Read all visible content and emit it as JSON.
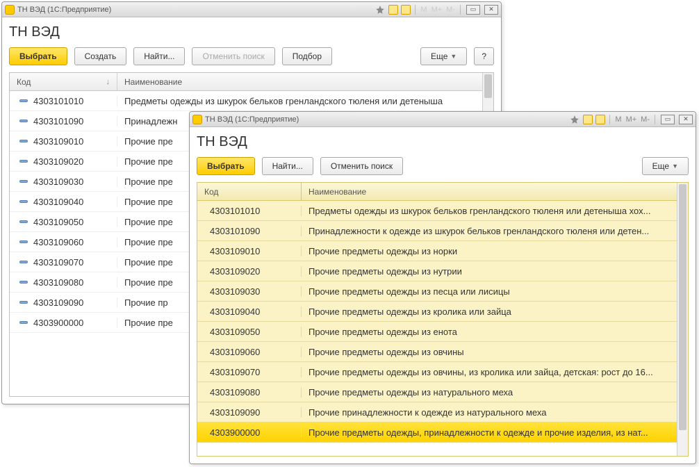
{
  "window1": {
    "title": "ТН ВЭД  (1С:Предприятие)",
    "page_title": "ТН ВЭД",
    "toolbar": {
      "choose": "Выбрать",
      "create": "Создать",
      "find": "Найти...",
      "cancel_search": "Отменить поиск",
      "pick": "Подбор",
      "more": "Еще",
      "help": "?"
    },
    "columns": {
      "code": "Код",
      "name": "Наименование"
    },
    "rows": [
      {
        "code": "4303101010",
        "name": "Предметы одежды из шкурок бельков гренландского тюленя или детеныша"
      },
      {
        "code": "4303101090",
        "name": "Принадлежн"
      },
      {
        "code": "4303109010",
        "name": "Прочие пре"
      },
      {
        "code": "4303109020",
        "name": "Прочие пре"
      },
      {
        "code": "4303109030",
        "name": "Прочие пре"
      },
      {
        "code": "4303109040",
        "name": "Прочие пре"
      },
      {
        "code": "4303109050",
        "name": "Прочие пре"
      },
      {
        "code": "4303109060",
        "name": "Прочие пре"
      },
      {
        "code": "4303109070",
        "name": "Прочие пре"
      },
      {
        "code": "4303109080",
        "name": "Прочие пре"
      },
      {
        "code": "4303109090",
        "name": "Прочие пр"
      },
      {
        "code": "4303900000",
        "name": "Прочие пре"
      }
    ]
  },
  "window2": {
    "title": "ТН ВЭД  (1С:Предприятие)",
    "page_title": "ТН ВЭД",
    "toolbar": {
      "choose": "Выбрать",
      "find": "Найти...",
      "cancel_search": "Отменить поиск",
      "more": "Еще"
    },
    "mem": {
      "m": "M",
      "mplus": "M+",
      "mminus": "M-"
    },
    "columns": {
      "code": "Код",
      "name": "Наименование"
    },
    "selected_index": 11,
    "rows": [
      {
        "code": "4303101010",
        "name": "Предметы одежды из шкурок бельков гренландского тюленя или детеныша хох..."
      },
      {
        "code": "4303101090",
        "name": "Принадлежности к одежде из шкурок бельков гренландского тюленя или детен..."
      },
      {
        "code": "4303109010",
        "name": "Прочие предметы одежды из норки"
      },
      {
        "code": "4303109020",
        "name": "Прочие предметы одежды из нутрии"
      },
      {
        "code": "4303109030",
        "name": "Прочие предметы одежды из песца или лисицы"
      },
      {
        "code": "4303109040",
        "name": "Прочие предметы одежды из кролика или зайца"
      },
      {
        "code": "4303109050",
        "name": "Прочие предметы одежды из енота"
      },
      {
        "code": "4303109060",
        "name": "Прочие предметы одежды из овчины"
      },
      {
        "code": "4303109070",
        "name": "Прочие предметы одежды из овчины, из кролика или зайца, детская: рост до 16..."
      },
      {
        "code": "4303109080",
        "name": "Прочие предметы одежды из натурального меха"
      },
      {
        "code": "4303109090",
        "name": "Прочие принадлежности к одежде из натурального меха"
      },
      {
        "code": "4303900000",
        "name": "Прочие предметы одежды, принадлежности к одежде и прочие изделия, из нат..."
      }
    ]
  }
}
